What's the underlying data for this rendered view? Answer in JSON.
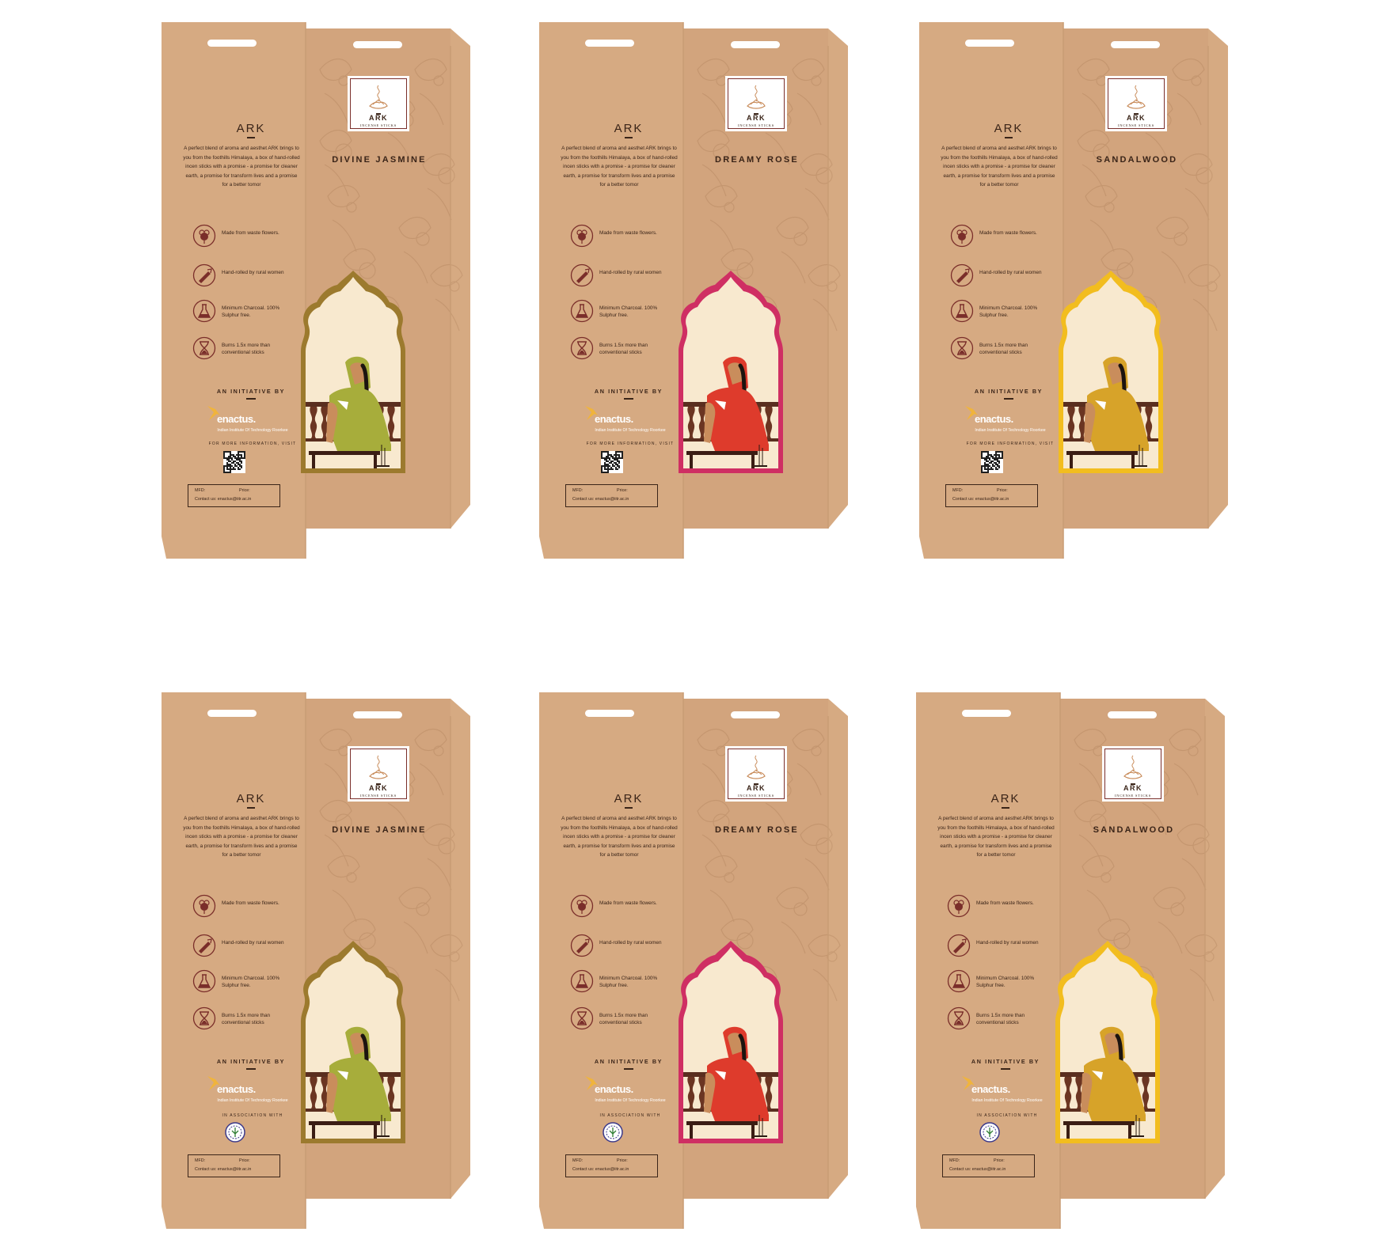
{
  "content": {
    "brand": "ARK",
    "description": "A perfect blend of aroma and aesthet ARK brings to you from the foothills Himalaya, a box of hand-rolled incen sticks with a promise - a promise for cleaner earth, a promise for transform lives and a promise for a better tomor",
    "features": [
      {
        "icon": "flower-icon",
        "text": "Made from waste flowers."
      },
      {
        "icon": "hand-rolling-icon",
        "text": "Hand-rolled by rural women"
      },
      {
        "icon": "flask-icon",
        "text": "Minimum Charcoal. 100% Sulphur free."
      },
      {
        "icon": "hourglass-icon",
        "text": "Burns 1.5x more than conventional sticks"
      }
    ],
    "initiative": "AN INITIATIVE BY",
    "enactus": "enactus.",
    "iitr": "Indian Institute Of Technology Roorkee",
    "more_info": "FOR MORE INFORMATION, VISIT",
    "association": "IN ASSOCIATION WITH",
    "mfd": "MFD:",
    "price": "Price:",
    "contact": "Contact us: enactus@iitr.ac.in",
    "card_brand": "ARK",
    "card_sub": "INCENSE STICKS"
  },
  "colors": {
    "kraft": "#d6aa82",
    "text": "#3a2418",
    "icon": "#7a2e2a",
    "enactus": "#f0b43c",
    "olive": "#9c7a2e",
    "rose": "#cf2f63",
    "sandal": "#f2bd1f"
  },
  "boxes": [
    {
      "fragrance": "DIVINE JASMINE",
      "frame": "#9c7a2e",
      "saree": "#a7ad3b",
      "footer": "qr"
    },
    {
      "fragrance": "DREAMY ROSE",
      "frame": "#cf2f63",
      "saree": "#de3b2c",
      "footer": "qr"
    },
    {
      "fragrance": "SANDALWOOD",
      "frame": "#f2bd1f",
      "saree": "#d7a329",
      "footer": "qr"
    },
    {
      "fragrance": "DIVINE JASMINE",
      "frame": "#9c7a2e",
      "saree": "#a7ad3b",
      "footer": "association"
    },
    {
      "fragrance": "DREAMY ROSE",
      "frame": "#cf2f63",
      "saree": "#de3b2c",
      "footer": "association"
    },
    {
      "fragrance": "SANDALWOOD",
      "frame": "#f2bd1f",
      "saree": "#d7a329",
      "footer": "association"
    }
  ]
}
